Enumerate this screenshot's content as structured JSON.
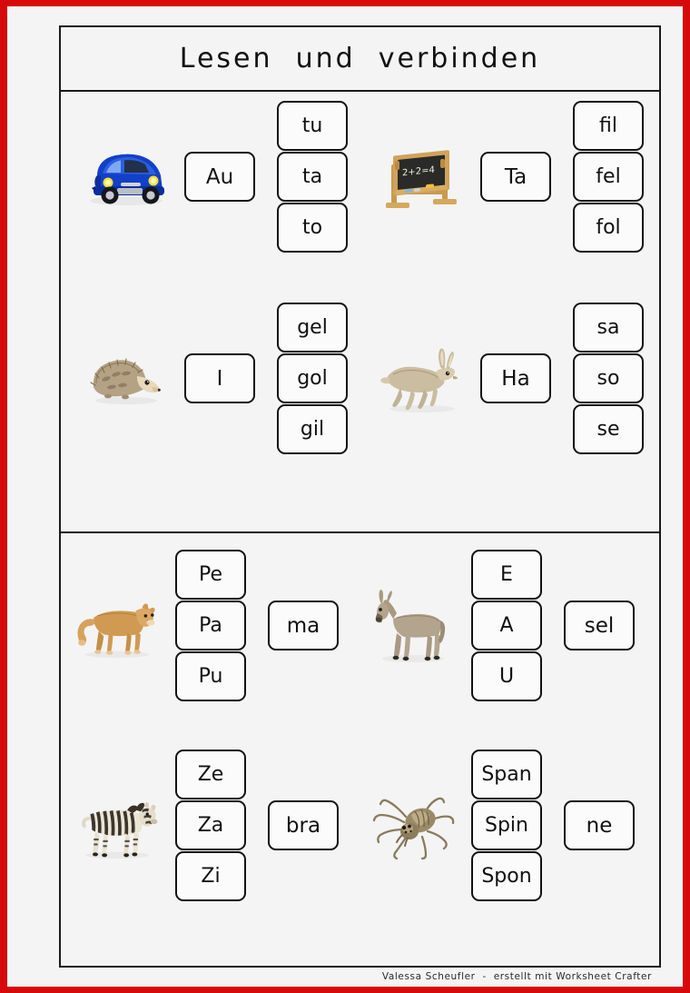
{
  "page": {
    "title": "Lesen  und  verbinden",
    "credit": "Valessa Scheufler  -  erstellt mit Worksheet Crafter",
    "border_color": "#d60a0a",
    "paper_color": "#f4f4f4",
    "ink_color": "#121212"
  },
  "sections": [
    {
      "id": "section-1",
      "layout": "picture-then-prefix-then-options",
      "rows": [
        {
          "id": "row-auto",
          "picture": "blue-car-image",
          "prefix": "Au",
          "options": [
            "tu",
            "ta",
            "to"
          ]
        },
        {
          "id": "row-tafel",
          "picture": "blackboard-image",
          "picture_text": "2+2=4",
          "prefix": "Ta",
          "options": [
            "fil",
            "fel",
            "fol"
          ]
        },
        {
          "id": "row-igel",
          "picture": "hedgehog-image",
          "prefix": "I",
          "options": [
            "gel",
            "gol",
            "gil"
          ]
        },
        {
          "id": "row-hase",
          "picture": "hare-image",
          "prefix": "Ha",
          "options": [
            "sa",
            "so",
            "se"
          ]
        }
      ]
    },
    {
      "id": "section-2",
      "layout": "picture-then-options-then-suffix",
      "rows": [
        {
          "id": "row-puma",
          "picture": "puma-image",
          "options": [
            "Pe",
            "Pa",
            "Pu"
          ],
          "suffix": "ma"
        },
        {
          "id": "row-esel",
          "picture": "donkey-image",
          "options": [
            "E",
            "A",
            "U"
          ],
          "suffix": "sel"
        },
        {
          "id": "row-zebra",
          "picture": "zebra-image",
          "options": [
            "Ze",
            "Za",
            "Zi"
          ],
          "suffix": "bra"
        },
        {
          "id": "row-spinne",
          "picture": "spider-image",
          "options": [
            "Span",
            "Spin",
            "Spon"
          ],
          "suffix": "ne"
        }
      ]
    }
  ]
}
